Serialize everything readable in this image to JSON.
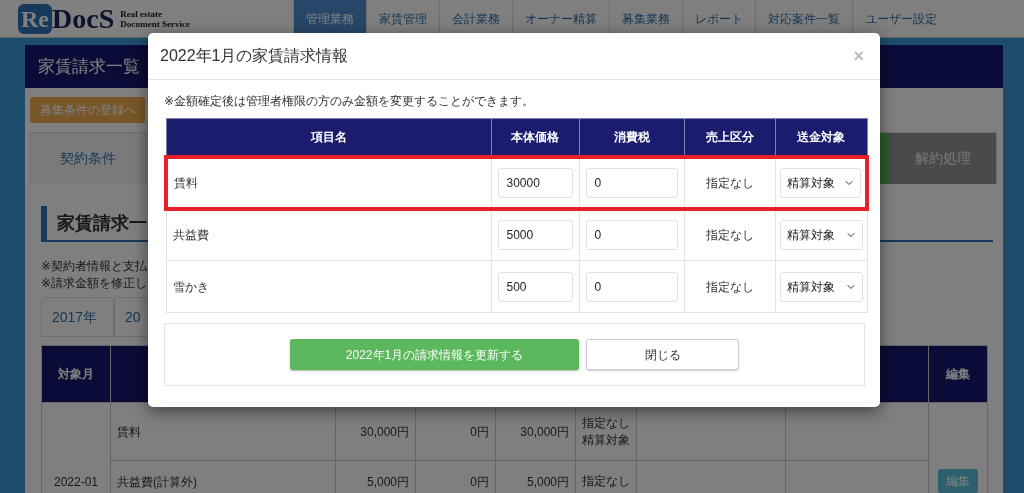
{
  "navbar": {
    "logo": {
      "mark": "Re",
      "name": "DocS",
      "tagline": [
        "Real estate",
        "Document Service"
      ]
    },
    "tabs": [
      {
        "label": "管理業務",
        "selected": true
      },
      {
        "label": "家賃管理",
        "selected": false
      },
      {
        "label": "会計業務",
        "selected": false
      },
      {
        "label": "オーナー精算",
        "selected": false
      },
      {
        "label": "募集業務",
        "selected": false
      },
      {
        "label": "レポート",
        "selected": false
      },
      {
        "label": "対応案件一覧",
        "selected": false
      },
      {
        "label": "ユーザー設定",
        "selected": false
      }
    ]
  },
  "page": {
    "title": "家賃請求一覧",
    "register_button": "募集条件の登録へ",
    "tabs": [
      {
        "kind": "default",
        "label": "契約条件"
      },
      {
        "kind": "success"
      },
      {
        "kind": "dark",
        "label": "解約処理"
      }
    ],
    "section_heading": "家賃請求一",
    "notes": [
      "※契約者情報と支払",
      "※請求金額を修正し"
    ],
    "year_tabs": [
      "2017年",
      "20"
    ],
    "table": {
      "columns": {
        "column_1": "対象月",
        "column_9": "編集"
      },
      "month": "2022-01",
      "edit_button": "編集",
      "rows": [
        {
          "item": "賃料",
          "amount": "30,000円",
          "tax": "0円",
          "total": "30,000円",
          "status": [
            "指定なし",
            "精算対象"
          ]
        },
        {
          "item": "共益費(計算外)",
          "amount": "5,000円",
          "tax": "0円",
          "total": "5,000円",
          "status": [
            "指定なし"
          ]
        }
      ]
    }
  },
  "modal": {
    "title": "2022年1月の家賃請求情報",
    "close": "×",
    "note": "※金額確定後は管理者権限の方のみ金額を変更することができます。",
    "columns": [
      "項目名",
      "本体価格",
      "消費税",
      "売上区分",
      "送金対象"
    ],
    "rows": [
      {
        "name": "賃料",
        "price": "30000",
        "tax": "0",
        "sales_category": "指定なし",
        "remit_target": "精算対象",
        "highlighted": true
      },
      {
        "name": "共益費",
        "price": "5000",
        "tax": "0",
        "sales_category": "指定なし",
        "remit_target": "精算対象",
        "highlighted": false
      },
      {
        "name": "雪かき",
        "price": "500",
        "tax": "0",
        "sales_category": "指定なし",
        "remit_target": "精算対象",
        "highlighted": false
      }
    ],
    "update_button": "2022年1月の請求情報を更新する",
    "close_button": "閉じる"
  }
}
